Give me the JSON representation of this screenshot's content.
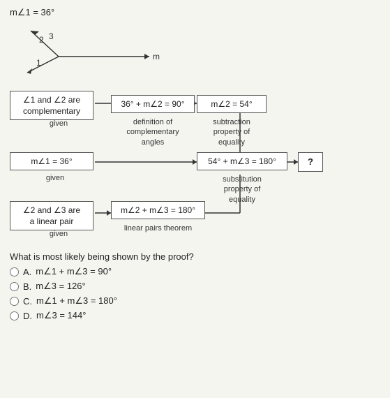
{
  "top_equation": "m∠1 = 36°",
  "diagram": {
    "label_m": "m",
    "label_2": "2",
    "label_3": "3",
    "label_1": "1"
  },
  "proof": {
    "box1": {
      "line1": "∠1 and ∠2 are",
      "line2": "complementary"
    },
    "box1_label": "given",
    "box2": {
      "text": "36° + m∠2 = 90°"
    },
    "box2_label1": "definition of",
    "box2_label2": "complementary",
    "box2_label3": "angles",
    "box3": {
      "text": "m∠2 = 54°"
    },
    "box3_label1": "subtraction",
    "box3_label2": "property of",
    "box3_label3": "equality",
    "box4": {
      "text": "m∠1 = 36°"
    },
    "box4_label": "given",
    "box5": {
      "text": "54° + m∠3 = 180°"
    },
    "box5_label1": "substitution",
    "box5_label2": "property of",
    "box5_label3": "equality",
    "box6": {
      "text": "?"
    },
    "box7": {
      "line1": "∠2 and ∠3 are",
      "line2": "a linear pair"
    },
    "box7_label": "given",
    "box8": {
      "text": "m∠2 + m∠3 = 180°"
    },
    "box8_label1": "linear pairs theorem"
  },
  "question": {
    "prompt": "What is most likely being shown by the proof?",
    "options": [
      {
        "id": "A",
        "text": "m∠1 + m∠3 = 90°"
      },
      {
        "id": "B",
        "text": "m∠3 = 126°"
      },
      {
        "id": "C",
        "text": "m∠1 + m∠3 = 180°"
      },
      {
        "id": "D",
        "text": "m∠3 = 144°"
      }
    ]
  }
}
